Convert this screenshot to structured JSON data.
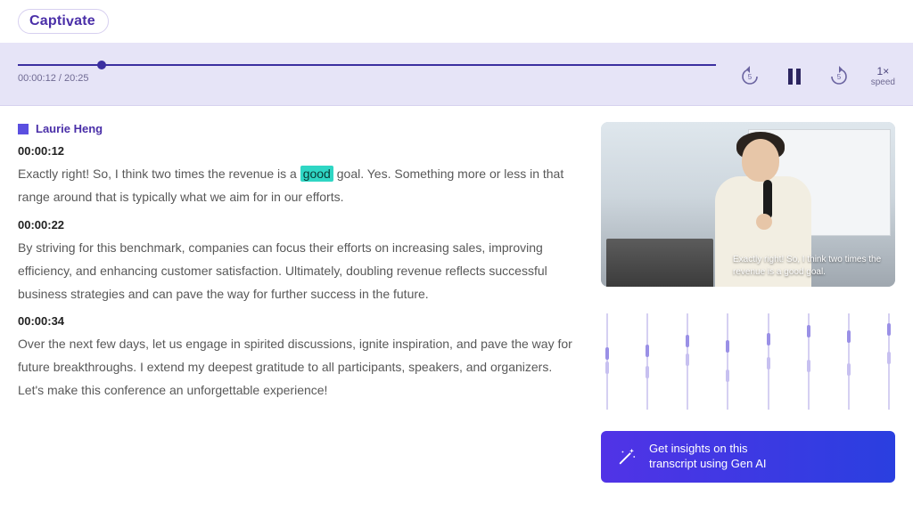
{
  "app": {
    "logo_text": "Captivate"
  },
  "player": {
    "current_time": "00:00:12",
    "duration": "20:25",
    "time_display": "00:00:12 / 20:25",
    "rewind_seconds": "5",
    "forward_seconds": "5",
    "speed_value": "1×",
    "speed_label": "speed"
  },
  "transcript": {
    "speaker": "Laurie Heng",
    "segments": [
      {
        "ts": "00:00:12",
        "text_pre": "Exactly right! So, I think two times the revenue is a ",
        "highlight": "good",
        "text_post": " goal. Yes. Something more or less in that range around that is typically what we aim for in our efforts."
      },
      {
        "ts": "00:00:22",
        "text": "By striving for this benchmark, companies can focus their efforts on increasing sales, improving efficiency, and enhancing customer satisfaction. Ultimately, doubling revenue reflects successful business strategies and can pave the way for further success in the future."
      },
      {
        "ts": "00:00:34",
        "text": "Over the next few days, let us engage in spirited discussions, ignite inspiration, and pave the way for future breakthroughs. I extend my deepest gratitude to all participants, speakers, and organizers. Let's make this conference an unforgettable experience!"
      }
    ]
  },
  "video": {
    "caption": "Exactly right! So, I think two times the revenue is a good goal."
  },
  "eq": {
    "sliders": [
      {
        "a": 35,
        "b": 50
      },
      {
        "a": 32,
        "b": 55
      },
      {
        "a": 22,
        "b": 42
      },
      {
        "a": 28,
        "b": 58
      },
      {
        "a": 20,
        "b": 45
      },
      {
        "a": 12,
        "b": 48
      },
      {
        "a": 18,
        "b": 52
      },
      {
        "a": 10,
        "b": 40
      }
    ]
  },
  "cta": {
    "line1": "Get insights on this",
    "line2": "transcript using Gen AI"
  }
}
